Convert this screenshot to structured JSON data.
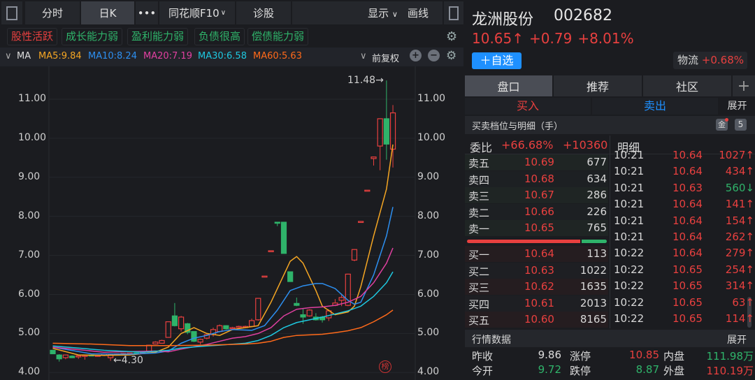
{
  "toolbar": {
    "tabs": [
      "分时",
      "日K",
      "•••",
      "同花顺F10",
      "诊股"
    ],
    "display": "显示",
    "draw": "画线",
    "f10_chevron": "chevron-down-icon",
    "display_chevron": "chevron-down-icon"
  },
  "tags": [
    {
      "label": "股性活跃",
      "color": "#e8403f"
    },
    {
      "label": "成长能力弱",
      "color": "#2fb36a"
    },
    {
      "label": "盈利能力弱",
      "color": "#2fb36a"
    },
    {
      "label": "负债很高",
      "color": "#2fb36a"
    },
    {
      "label": "偿债能力弱",
      "color": "#2fb36a"
    }
  ],
  "ma_bar": {
    "label": "MA",
    "items": [
      {
        "text": "MA5:9.84",
        "color": "#f5a623"
      },
      {
        "text": "MA10:8.24",
        "color": "#2d8ff0"
      },
      {
        "text": "MA20:7.19",
        "color": "#e040a0"
      },
      {
        "text": "MA30:6.58",
        "color": "#1ec8e0"
      },
      {
        "text": "MA60:5.63",
        "color": "#ff6a1a"
      }
    ],
    "adjust": "前复权"
  },
  "chart_data": {
    "type": "candlestick",
    "ylim": [
      4,
      11.5
    ],
    "yticks": [
      "11.00",
      "10.00",
      "9.00",
      "8.00",
      "7.00",
      "6.00",
      "5.00",
      "4.00"
    ],
    "annotations": {
      "high": "11.48→",
      "low": "←4.30",
      "badge": "榜"
    },
    "up_color": "#e8403f",
    "down_color": "#2fb36a",
    "ohlc": [
      [
        4.57,
        4.58,
        4.47,
        4.48
      ],
      [
        4.45,
        4.47,
        4.28,
        4.35
      ],
      [
        4.38,
        4.46,
        4.34,
        4.45
      ],
      [
        4.42,
        4.44,
        4.37,
        4.38
      ],
      [
        4.4,
        4.44,
        4.35,
        4.43
      ],
      [
        4.43,
        4.45,
        4.33,
        4.44
      ],
      [
        4.45,
        4.46,
        4.42,
        4.43
      ],
      [
        4.44,
        4.45,
        4.43,
        4.44
      ],
      [
        4.44,
        4.48,
        4.42,
        4.47
      ],
      [
        4.38,
        4.46,
        4.3,
        4.45
      ],
      [
        4.45,
        4.49,
        4.44,
        4.48
      ],
      [
        4.47,
        4.5,
        4.46,
        4.49
      ],
      [
        4.48,
        4.51,
        4.47,
        4.5
      ],
      [
        4.5,
        4.51,
        4.47,
        4.48
      ],
      [
        4.5,
        4.54,
        4.49,
        4.53
      ],
      [
        4.55,
        4.71,
        4.54,
        4.7
      ],
      [
        4.73,
        4.8,
        4.72,
        4.78
      ],
      [
        4.75,
        4.84,
        4.74,
        4.82
      ],
      [
        4.9,
        5.31,
        4.89,
        5.3
      ],
      [
        5.45,
        5.78,
        5.18,
        5.2
      ],
      [
        5.12,
        5.45,
        5.05,
        5.42
      ],
      [
        5.25,
        5.27,
        4.98,
        5.03
      ],
      [
        5.05,
        5.06,
        4.78,
        4.8
      ],
      [
        4.78,
        4.87,
        4.72,
        4.85
      ],
      [
        4.88,
        4.98,
        4.85,
        4.97
      ],
      [
        4.97,
        5.15,
        4.92,
        5.1
      ],
      [
        5.05,
        5.23,
        5.03,
        5.2
      ],
      [
        5.2,
        5.21,
        5.1,
        5.12
      ],
      [
        5.13,
        5.17,
        5.1,
        5.15
      ],
      [
        5.15,
        5.2,
        5.12,
        5.18
      ],
      [
        5.17,
        5.2,
        5.16,
        5.18
      ],
      [
        5.18,
        5.38,
        5.16,
        5.33
      ],
      [
        5.35,
        5.91,
        5.33,
        5.9
      ],
      [
        6.47,
        6.47,
        6.47,
        6.47
      ],
      [
        7.12,
        7.12,
        7.12,
        7.12
      ],
      [
        7.85,
        7.86,
        7.75,
        7.84
      ],
      [
        7.85,
        7.86,
        7.05,
        7.05
      ],
      [
        6.58,
        6.59,
        6.33,
        6.33
      ],
      [
        5.77,
        5.92,
        5.7,
        5.72
      ],
      [
        5.48,
        5.65,
        5.25,
        5.42
      ],
      [
        5.45,
        5.62,
        5.43,
        5.6
      ],
      [
        5.42,
        5.52,
        5.33,
        5.35
      ],
      [
        5.42,
        5.45,
        5.28,
        5.35
      ],
      [
        5.4,
        5.62,
        5.32,
        5.58
      ],
      [
        5.72,
        5.88,
        5.7,
        5.78
      ],
      [
        5.85,
        6.02,
        5.7,
        5.92
      ],
      [
        5.72,
        6.53,
        5.7,
        6.52
      ],
      [
        6.88,
        7.16,
        6.85,
        7.15
      ],
      [
        7.87,
        7.87,
        7.87,
        7.87
      ],
      [
        8.67,
        8.67,
        8.67,
        8.67
      ],
      [
        9.48,
        9.53,
        9.3,
        9.52
      ],
      [
        9.8,
        10.5,
        9.18,
        10.5
      ],
      [
        10.5,
        11.48,
        9.45,
        9.85
      ],
      [
        9.72,
        10.85,
        9.25,
        10.65
      ]
    ],
    "ma": [
      {
        "name": "MA5",
        "color": "#f5a623",
        "x": [
          0,
          4,
          8,
          12,
          16,
          18,
          20,
          22,
          24,
          26,
          28,
          30,
          32,
          34,
          36,
          37,
          38,
          39,
          41,
          42,
          44,
          46,
          47,
          48,
          50,
          52,
          53
        ],
        "y": [
          4.62,
          4.45,
          4.44,
          4.45,
          4.52,
          4.65,
          5.0,
          5.15,
          5.0,
          4.95,
          5.1,
          5.15,
          5.2,
          5.8,
          6.5,
          6.85,
          6.97,
          6.8,
          6.1,
          5.7,
          5.48,
          5.55,
          5.7,
          6.2,
          7.5,
          8.7,
          9.84
        ]
      },
      {
        "name": "MA10",
        "color": "#2d8ff0",
        "x": [
          0,
          6,
          12,
          16,
          18,
          20,
          22,
          24,
          26,
          28,
          31,
          33,
          35,
          37,
          39,
          41,
          42,
          44,
          46,
          47,
          48,
          50,
          52,
          53
        ],
        "y": [
          4.65,
          4.48,
          4.47,
          4.5,
          4.55,
          4.75,
          4.88,
          4.95,
          5.05,
          5.1,
          5.08,
          5.2,
          5.6,
          6.1,
          6.22,
          6.28,
          6.28,
          6.15,
          5.85,
          5.75,
          5.8,
          6.5,
          7.5,
          8.24
        ]
      },
      {
        "name": "MA20",
        "color": "#e040a0",
        "x": [
          0,
          8,
          16,
          18,
          20,
          24,
          26,
          28,
          30,
          32,
          34,
          36,
          38,
          40,
          42,
          44,
          46,
          48,
          50,
          52,
          53
        ],
        "y": [
          4.65,
          4.52,
          4.55,
          4.53,
          4.6,
          4.72,
          4.8,
          4.88,
          4.92,
          5.0,
          5.15,
          5.45,
          5.62,
          5.66,
          5.68,
          5.72,
          5.8,
          5.95,
          6.3,
          6.8,
          7.19
        ]
      },
      {
        "name": "MA30",
        "color": "#1ec8e0",
        "x": [
          0,
          8,
          14,
          18,
          20,
          24,
          26,
          30,
          32,
          34,
          36,
          38,
          40,
          42,
          44,
          46,
          48,
          50,
          52,
          53
        ],
        "y": [
          4.68,
          4.57,
          4.52,
          4.57,
          4.63,
          4.68,
          4.7,
          4.75,
          4.82,
          4.95,
          5.15,
          5.28,
          5.35,
          5.42,
          5.5,
          5.58,
          5.7,
          5.95,
          6.3,
          6.58
        ]
      },
      {
        "name": "MA60",
        "color": "#ff6a1a",
        "x": [
          0,
          6,
          12,
          18,
          24,
          30,
          32,
          34,
          36,
          38,
          42,
          44,
          46,
          48,
          50,
          52,
          53
        ],
        "y": [
          4.75,
          4.73,
          4.69,
          4.69,
          4.7,
          4.73,
          4.75,
          4.8,
          4.9,
          4.95,
          4.98,
          5.02,
          5.07,
          5.15,
          5.3,
          5.48,
          5.6
        ]
      }
    ]
  },
  "stock": {
    "name": "龙洲股份",
    "code": "002682",
    "price": "10.65↑",
    "change": "+0.79",
    "pct": "+8.01%",
    "add_watch": "＋自选",
    "sector": "物流",
    "sector_pct": "+0.68%"
  },
  "tabs": [
    "盘口",
    "推荐",
    "社区",
    "+"
  ],
  "trade": {
    "buy": "买入",
    "sell": "卖出",
    "expand": "展开"
  },
  "book": {
    "title": "买卖档位与明细（手）",
    "gold": "金",
    "level": "5",
    "wb_label": "委比",
    "wb_pct": "+66.68%",
    "wb_diff": "+10360",
    "detail_label": "明细",
    "sell": [
      [
        "卖五",
        "10.69",
        "677"
      ],
      [
        "卖四",
        "10.68",
        "634"
      ],
      [
        "卖三",
        "10.67",
        "286"
      ],
      [
        "卖二",
        "10.66",
        "226"
      ],
      [
        "卖一",
        "10.65",
        "765"
      ]
    ],
    "buy": [
      [
        "买一",
        "10.64",
        "113"
      ],
      [
        "买二",
        "10.63",
        "1022"
      ],
      [
        "买三",
        "10.62",
        "1635"
      ],
      [
        "买四",
        "10.61",
        "2013"
      ],
      [
        "买五",
        "10.60",
        "8165"
      ]
    ],
    "buy_ratio": 0.81,
    "ticks": [
      [
        "10:21",
        "10.64",
        "1027↑",
        "up"
      ],
      [
        "10:21",
        "10.64",
        "434↑",
        "up"
      ],
      [
        "10:21",
        "10.63",
        "560↓",
        "down"
      ],
      [
        "10:21",
        "10.64",
        "141↑",
        "up"
      ],
      [
        "10:21",
        "10.64",
        "154↑",
        "up"
      ],
      [
        "10:21",
        "10.64",
        "262↑",
        "up"
      ],
      [
        "10:22",
        "10.64",
        "279↑",
        "up"
      ],
      [
        "10:22",
        "10.65",
        "254↑",
        "up"
      ],
      [
        "10:22",
        "10.65",
        "314↑",
        "up"
      ],
      [
        "10:22",
        "10.65",
        "63↑",
        "up"
      ],
      [
        "10:22",
        "10.65",
        "114↑",
        "up"
      ]
    ]
  },
  "quote": {
    "title": "行情数据",
    "expand": "展开",
    "rows": [
      [
        "昨收",
        "9.86",
        "涨停",
        "10.85",
        "内盘",
        "111.98万"
      ],
      [
        "今开",
        "9.72",
        "跌停",
        "8.87",
        "外盘",
        "110.19万"
      ]
    ]
  }
}
